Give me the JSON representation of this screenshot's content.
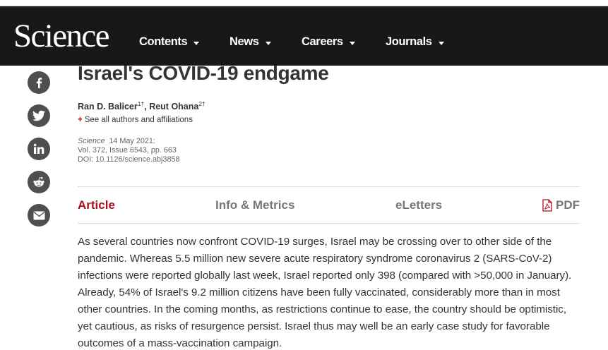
{
  "header": {
    "logo": "Science",
    "nav": [
      {
        "label": "Contents"
      },
      {
        "label": "News"
      },
      {
        "label": "Careers"
      },
      {
        "label": "Journals"
      }
    ]
  },
  "share_icons": [
    "facebook-icon",
    "twitter-icon",
    "linkedin-icon",
    "reddit-icon",
    "email-icon"
  ],
  "article": {
    "title": "Israel's COVID-19 endgame",
    "authors": [
      {
        "name": "Ran D. Balicer",
        "sup": "1†"
      },
      {
        "name": "Reut Ohana",
        "sup": "2†"
      }
    ],
    "author_separator": ", ",
    "affiliations_link": "See all authors and affiliations",
    "journal": "Science",
    "date": "14 May 2021:",
    "volume_line": "Vol. 372, Issue 6543, pp. 663",
    "doi_line": "DOI: 10.1126/science.abj3858"
  },
  "tabs": [
    {
      "label": "Article",
      "active": true
    },
    {
      "label": "Info & Metrics",
      "active": false
    },
    {
      "label": "eLetters",
      "active": false
    },
    {
      "label": "PDF",
      "active": false
    }
  ],
  "abstract": "As several countries now confront COVID-19 surges, Israel may be crossing over to other side of the pandemic. Whereas 5.5 million new severe acute respiratory syndrome coronavirus 2 (SARS-CoV-2) infections were reported globally last week, Israel reported only 398 (compared with >50,000 in January). Already, 54% of Israel's 9.2 million citizens have been fully vaccinated, considerably more than in most other countries. In the coming months, as restrictions continue to ease, the country should be optimistic, yet cautious, as risks of resurgence persist. Israel thus may well be an early case study for favorable outcomes of a mass-vaccination campaign.",
  "colors": {
    "navbar": "#181818",
    "accent": "#b00d1e",
    "share_circle": "#4f4f4f"
  }
}
